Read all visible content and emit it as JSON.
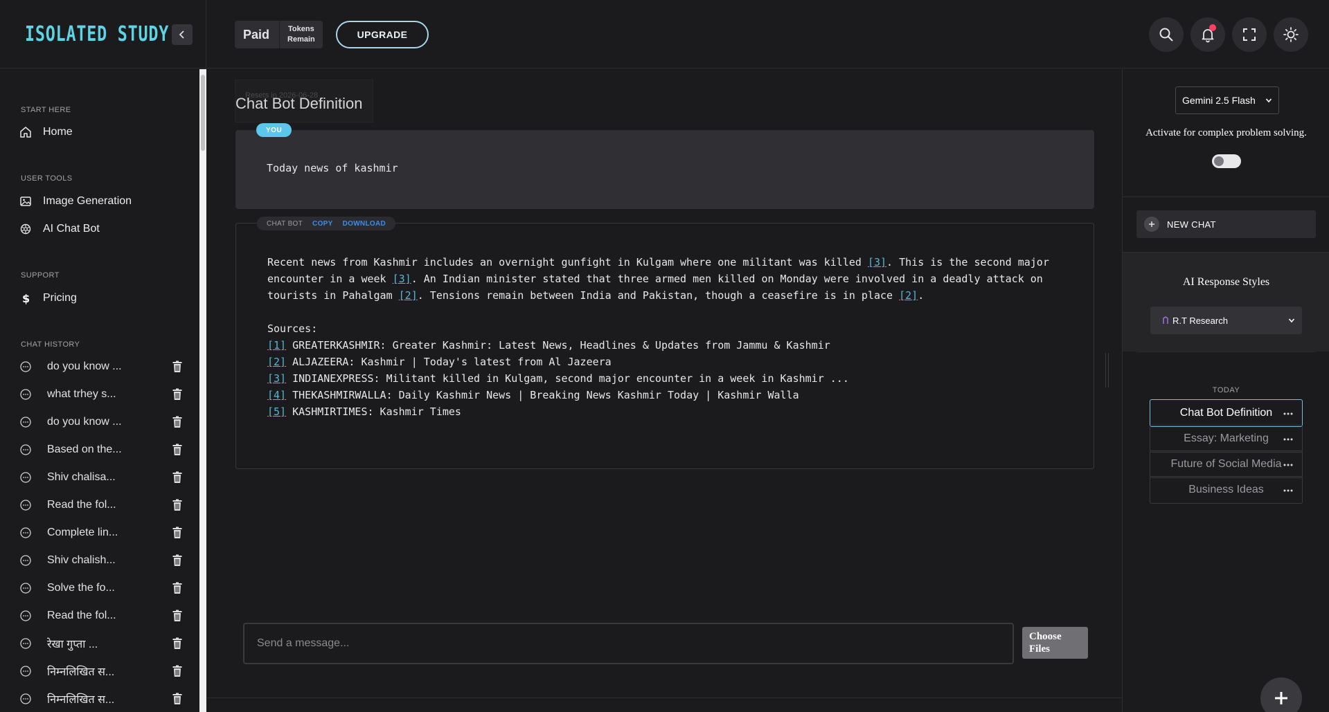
{
  "app": {
    "logo": "ISOLATED STUDY"
  },
  "topbar": {
    "plan": "Paid",
    "tokens_line1": "Tokens",
    "tokens_line2": "Remain",
    "upgrade_label": "UPGRADE",
    "icons": [
      "search-icon",
      "bell-icon",
      "fullscreen-icon",
      "sun-icon"
    ]
  },
  "sidebar": {
    "sections": {
      "start": "START HERE",
      "user_tools": "USER TOOLS",
      "support": "SUPPORT",
      "history": "CHAT HISTORY"
    },
    "nav": {
      "home": "Home",
      "image_generation": "Image Generation",
      "ai_chat_bot": "AI Chat Bot",
      "pricing": "Pricing"
    },
    "history": [
      "do you know ...",
      "what trhey s...",
      "do you know ...",
      "Based on the...",
      "Shiv chalisa...",
      "Read the fol...",
      "Complete lin...",
      "Shiv chalish...",
      "Solve the fo...",
      "Read the fol...",
      "रेखा गुप्ता ...",
      "निम्नलिखित स...",
      "निम्नलिखित स..."
    ]
  },
  "main": {
    "resets_text": "Resets in 2026-06-28",
    "title": "Chat Bot Definition",
    "user_tag": "YOU",
    "user_message": "Today news of kashmir",
    "bot_tag": "CHAT BOT",
    "copy_label": "COPY",
    "download_label": "DOWNLOAD",
    "bot_paragraph": [
      {
        "t": "Recent news from Kashmir includes an overnight gunfight in Kulgam where one militant was killed "
      },
      {
        "c": "[3]"
      },
      {
        "t": ". This is the second major encounter in a week "
      },
      {
        "c": "[3]"
      },
      {
        "t": ".  An Indian minister stated that three armed men killed on Monday were involved in a deadly attack on tourists in Pahalgam "
      },
      {
        "c": "[2]"
      },
      {
        "t": ". Tensions remain between India and Pakistan, though a ceasefire is in place "
      },
      {
        "c": "[2]"
      },
      {
        "t": "."
      }
    ],
    "sources_label": "Sources:",
    "sources": [
      {
        "ref": "[1]",
        "text": "GREATERKASHMIR: Greater Kashmir: Latest News, Headlines & Updates from Jammu & Kashmir"
      },
      {
        "ref": "[2]",
        "text": "ALJAZEERA: Kashmir | Today's latest from Al Jazeera"
      },
      {
        "ref": "[3]",
        "text": "INDIANEXPRESS: Militant killed in Kulgam, second major encounter in a week in Kashmir ..."
      },
      {
        "ref": "[4]",
        "text": "THEKASHMIRWALLA: Daily Kashmir News | Breaking News Kashmir Today | Kashmir Walla"
      },
      {
        "ref": "[5]",
        "text": "KASHMIRTIMES: Kashmir Times"
      }
    ],
    "input_placeholder": "Send a message...",
    "choose_files": "Choose Files"
  },
  "right_panel": {
    "model": "Gemini 2.5 Flash",
    "activate_text": "Activate for complex problem solving.",
    "new_chat": "NEW CHAT",
    "styles_title": "AI Response Styles",
    "style_selected": "R.T Research",
    "today_label": "TODAY",
    "conversations": [
      {
        "title": "Chat Bot Definition",
        "active": true
      },
      {
        "title": "Essay: Marketing",
        "active": false
      },
      {
        "title": "Future of Social Media",
        "active": false
      },
      {
        "title": "Business Ideas",
        "active": false
      }
    ]
  },
  "colors": {
    "accent": "#5ed3e3",
    "you_tag": "#5cc7ea",
    "link": "#3b8ee8",
    "notif": "#ff3f63"
  }
}
